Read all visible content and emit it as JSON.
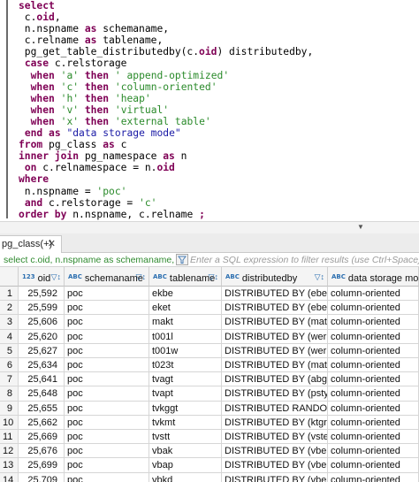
{
  "editor": {
    "lines": [
      [
        {
          "t": "select",
          "k": "kw"
        }
      ],
      [
        {
          "t": " c.",
          "k": ""
        },
        {
          "t": "oid",
          "k": "kw"
        },
        {
          "t": ",",
          "k": ""
        }
      ],
      [
        {
          "t": " n.nspname ",
          "k": ""
        },
        {
          "t": "as",
          "k": "kw"
        },
        {
          "t": " schemaname,",
          "k": ""
        }
      ],
      [
        {
          "t": " c.relname ",
          "k": ""
        },
        {
          "t": "as",
          "k": "kw"
        },
        {
          "t": " tablename,",
          "k": ""
        }
      ],
      [
        {
          "t": " pg_get_table_distributedby(c.",
          "k": ""
        },
        {
          "t": "oid",
          "k": "kw"
        },
        {
          "t": ") distributedby,",
          "k": ""
        }
      ],
      [
        {
          "t": " ",
          "k": ""
        },
        {
          "t": "case",
          "k": "kw"
        },
        {
          "t": " c.relstorage",
          "k": ""
        }
      ],
      [
        {
          "t": "  ",
          "k": ""
        },
        {
          "t": "when",
          "k": "kw"
        },
        {
          "t": " ",
          "k": ""
        },
        {
          "t": "'a'",
          "k": "str"
        },
        {
          "t": " ",
          "k": ""
        },
        {
          "t": "then",
          "k": "kw"
        },
        {
          "t": " ",
          "k": ""
        },
        {
          "t": "' append-optimized'",
          "k": "str"
        }
      ],
      [
        {
          "t": "  ",
          "k": ""
        },
        {
          "t": "when",
          "k": "kw"
        },
        {
          "t": " ",
          "k": ""
        },
        {
          "t": "'c'",
          "k": "str"
        },
        {
          "t": " ",
          "k": ""
        },
        {
          "t": "then",
          "k": "kw"
        },
        {
          "t": " ",
          "k": ""
        },
        {
          "t": "'column-oriented'",
          "k": "str"
        }
      ],
      [
        {
          "t": "  ",
          "k": ""
        },
        {
          "t": "when",
          "k": "kw"
        },
        {
          "t": " ",
          "k": ""
        },
        {
          "t": "'h'",
          "k": "str"
        },
        {
          "t": " ",
          "k": ""
        },
        {
          "t": "then",
          "k": "kw"
        },
        {
          "t": " ",
          "k": ""
        },
        {
          "t": "'heap'",
          "k": "str"
        }
      ],
      [
        {
          "t": "  ",
          "k": ""
        },
        {
          "t": "when",
          "k": "kw"
        },
        {
          "t": " ",
          "k": ""
        },
        {
          "t": "'v'",
          "k": "str"
        },
        {
          "t": " ",
          "k": ""
        },
        {
          "t": "then",
          "k": "kw"
        },
        {
          "t": " ",
          "k": ""
        },
        {
          "t": "'virtual'",
          "k": "str"
        }
      ],
      [
        {
          "t": "  ",
          "k": ""
        },
        {
          "t": "when",
          "k": "kw"
        },
        {
          "t": " ",
          "k": ""
        },
        {
          "t": "'x'",
          "k": "str"
        },
        {
          "t": " ",
          "k": ""
        },
        {
          "t": "then",
          "k": "kw"
        },
        {
          "t": " ",
          "k": ""
        },
        {
          "t": "'external table'",
          "k": "str"
        }
      ],
      [
        {
          "t": " ",
          "k": ""
        },
        {
          "t": "end",
          "k": "kw"
        },
        {
          "t": " ",
          "k": ""
        },
        {
          "t": "as",
          "k": "kw"
        },
        {
          "t": " ",
          "k": ""
        },
        {
          "t": "\"data storage mode\"",
          "k": "dq"
        }
      ],
      [
        {
          "t": "from",
          "k": "kw"
        },
        {
          "t": " pg_class ",
          "k": ""
        },
        {
          "t": "as",
          "k": "kw"
        },
        {
          "t": " c",
          "k": ""
        }
      ],
      [
        {
          "t": "inner join",
          "k": "kw"
        },
        {
          "t": " pg_namespace ",
          "k": ""
        },
        {
          "t": "as",
          "k": "kw"
        },
        {
          "t": " n",
          "k": ""
        }
      ],
      [
        {
          "t": " ",
          "k": ""
        },
        {
          "t": "on",
          "k": "kw"
        },
        {
          "t": " c.relnamespace = n.",
          "k": ""
        },
        {
          "t": "oid",
          "k": "kw"
        }
      ],
      [
        {
          "t": "where",
          "k": "kw"
        }
      ],
      [
        {
          "t": " n.nspname = ",
          "k": ""
        },
        {
          "t": "'poc'",
          "k": "str"
        }
      ],
      [
        {
          "t": " ",
          "k": ""
        },
        {
          "t": "and",
          "k": "kw"
        },
        {
          "t": " c.relstorage = ",
          "k": ""
        },
        {
          "t": "'c'",
          "k": "str"
        }
      ],
      [
        {
          "t": "order by",
          "k": "kw"
        },
        {
          "t": " n.nspname, c.relname ",
          "k": ""
        },
        {
          "t": ";",
          "k": "kw"
        }
      ]
    ]
  },
  "results_tab": {
    "label": "pg_class(+)",
    "close": "✕"
  },
  "filter": {
    "sql_preview": "select c.oid, n.nspname as schemaname, c.relname as tablename",
    "placeholder": "Enter a SQL expression to filter results (use Ctrl+Space)"
  },
  "columns": [
    {
      "name": "oid",
      "type_icon": "123"
    },
    {
      "name": "schemaname",
      "type_icon": "ABC"
    },
    {
      "name": "tablename",
      "type_icon": "ABC"
    },
    {
      "name": "distributedby",
      "type_icon": "ABC"
    },
    {
      "name": "data storage mode",
      "type_icon": "ABC"
    }
  ],
  "rows": [
    [
      "1",
      "25,592",
      "poc",
      "ekbe",
      "DISTRIBUTED BY (ebeln)",
      "column-oriented"
    ],
    [
      "2",
      "25,599",
      "poc",
      "eket",
      "DISTRIBUTED BY (ebeln)",
      "column-oriented"
    ],
    [
      "3",
      "25,606",
      "poc",
      "makt",
      "DISTRIBUTED BY (matnr)",
      "column-oriented"
    ],
    [
      "4",
      "25,620",
      "poc",
      "t001l",
      "DISTRIBUTED BY (werks)",
      "column-oriented"
    ],
    [
      "5",
      "25,627",
      "poc",
      "t001w",
      "DISTRIBUTED BY (werks)",
      "column-oriented"
    ],
    [
      "6",
      "25,634",
      "poc",
      "t023t",
      "DISTRIBUTED BY (matkl)",
      "column-oriented"
    ],
    [
      "7",
      "25,641",
      "poc",
      "tvagt",
      "DISTRIBUTED BY (abgru)",
      "column-oriented"
    ],
    [
      "8",
      "25,648",
      "poc",
      "tvapt",
      "DISTRIBUTED BY (pstyv)",
      "column-oriented"
    ],
    [
      "9",
      "25,655",
      "poc",
      "tvkggt",
      "DISTRIBUTED RANDOMLY",
      "column-oriented"
    ],
    [
      "10",
      "25,662",
      "poc",
      "tvkmt",
      "DISTRIBUTED BY (ktgrm)",
      "column-oriented"
    ],
    [
      "11",
      "25,669",
      "poc",
      "tvstt",
      "DISTRIBUTED BY (vstel)",
      "column-oriented"
    ],
    [
      "12",
      "25,676",
      "poc",
      "vbak",
      "DISTRIBUTED BY (vbeln)",
      "column-oriented"
    ],
    [
      "13",
      "25,699",
      "poc",
      "vbap",
      "DISTRIBUTED BY (vbeln)",
      "column-oriented"
    ],
    [
      "14",
      "25,709",
      "poc",
      "vbkd",
      "DISTRIBUTED BY (vbeln)",
      "column-oriented"
    ]
  ]
}
